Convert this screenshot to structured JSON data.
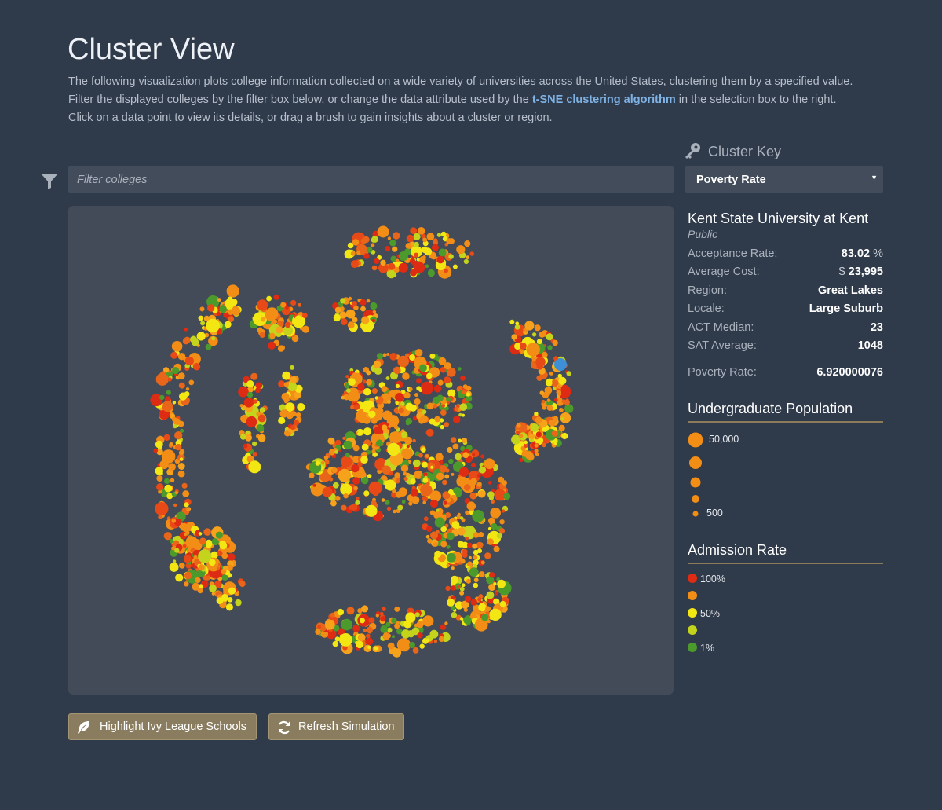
{
  "header": {
    "title": "Cluster View",
    "intro_1": "The following visualization plots college information collected on a wide variety of universities across the United States, clustering them by a specified value.",
    "intro_2a": "Filter the displayed colleges by the filter box below, or change the data attribute used by the ",
    "intro_link": "t-SNE clustering algorithm",
    "intro_2b": " in the selection box to the right.",
    "intro_3": "Click on a data point to view its details, or drag a brush to gain insights about a cluster or region."
  },
  "filter": {
    "placeholder": "Filter colleges",
    "value": ""
  },
  "cluster_key": {
    "title": "Cluster Key",
    "selected": "Poverty Rate"
  },
  "college": {
    "name": "Kent State University at Kent",
    "type": "Public",
    "stats": [
      {
        "label": "Acceptance Rate:",
        "value": "83.02",
        "unit_after": " %"
      },
      {
        "label": "Average Cost:",
        "value": "23,995",
        "unit_before": "$ "
      },
      {
        "label": "Region:",
        "value": "Great Lakes"
      },
      {
        "label": "Locale:",
        "value": "Large Suburb"
      },
      {
        "label": "ACT Median:",
        "value": "23"
      },
      {
        "label": "SAT Average:",
        "value": "1048"
      }
    ],
    "poverty": {
      "label": "Poverty Rate:",
      "value": "6.920000076"
    }
  },
  "population_legend": {
    "title": "Undergraduate Population",
    "max_label": "50,000",
    "min_label": "500"
  },
  "admission_legend": {
    "title": "Admission Rate",
    "items": [
      {
        "label": "100%",
        "color": "#dd2b14"
      },
      {
        "label": "",
        "color": "#f28d16"
      },
      {
        "label": "50%",
        "color": "#f3e713"
      },
      {
        "label": "",
        "color": "#c4d31b"
      },
      {
        "label": "1%",
        "color": "#4d9a2c"
      }
    ]
  },
  "buttons": {
    "ivy": "Highlight Ivy League Schools",
    "refresh": "Refresh Simulation"
  },
  "colors": {
    "accent_link": "#7fb3e6",
    "selected_point": "#3d8fd8",
    "orange": "#f28d16",
    "button_bg": "#8a7c5e"
  }
}
